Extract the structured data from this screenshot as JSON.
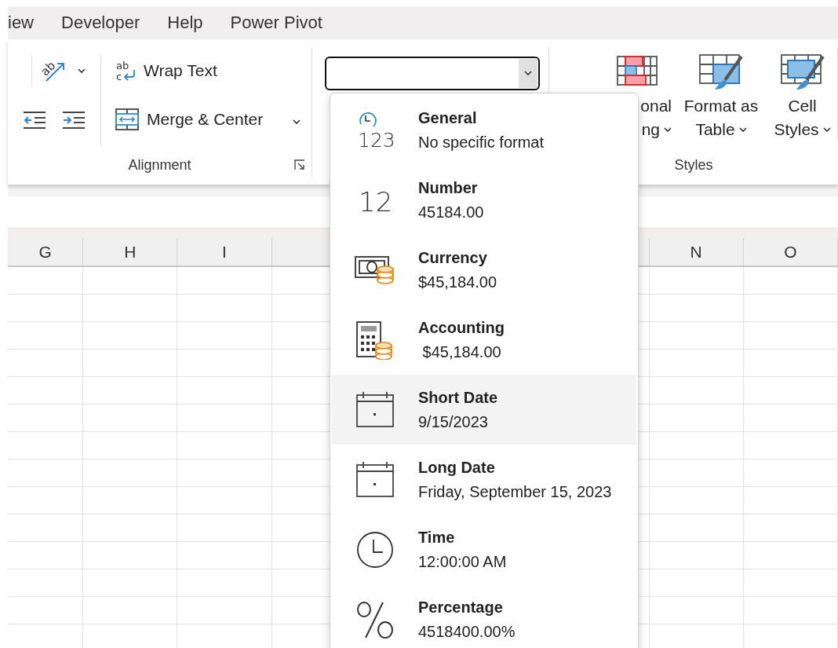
{
  "tabs": [
    {
      "label": "iew"
    },
    {
      "label": "Developer"
    },
    {
      "label": "Help"
    },
    {
      "label": "Power Pivot"
    }
  ],
  "alignment_group": {
    "label": "Alignment",
    "orientation_icon_text": "ab",
    "wrap_icon_text": [
      "ab",
      "c"
    ],
    "wrap_text": "Wrap Text",
    "merge_center": "Merge & Center"
  },
  "number_format_box": {
    "expanded": true
  },
  "styles_group": {
    "label": "Styles",
    "buttons": [
      {
        "kind": "conditional",
        "lines": [
          "onal",
          "ng"
        ]
      },
      {
        "kind": "table",
        "lines": [
          "Format as",
          "Table"
        ]
      },
      {
        "kind": "cell",
        "lines": [
          "Cell",
          "Styles"
        ]
      }
    ]
  },
  "format_menu": {
    "items": [
      {
        "kind": "general",
        "icon_text": "123",
        "name": "General",
        "example": "No specific format",
        "selected": false
      },
      {
        "kind": "number",
        "icon_text": "12",
        "name": "Number",
        "example": "45184.00",
        "selected": false
      },
      {
        "kind": "currency",
        "name": "Currency",
        "example": "$45,184.00",
        "selected": false
      },
      {
        "kind": "accounting",
        "name": "Accounting",
        "example": " $45,184.00",
        "selected": false
      },
      {
        "kind": "date",
        "name": "Short Date",
        "example": "9/15/2023",
        "selected": true
      },
      {
        "kind": "date",
        "name": "Long Date",
        "example": "Friday, September 15, 2023",
        "selected": false
      },
      {
        "kind": "time",
        "name": "Time",
        "example": "12:00:00 AM",
        "selected": false
      },
      {
        "kind": "percentage",
        "name": "Percentage",
        "example": "4518400.00%",
        "selected": false
      }
    ]
  },
  "sheet": {
    "columns": [
      {
        "label": "G"
      },
      {
        "label": "H"
      },
      {
        "label": "I"
      },
      {
        "label": "N"
      },
      {
        "label": "O"
      }
    ]
  }
}
